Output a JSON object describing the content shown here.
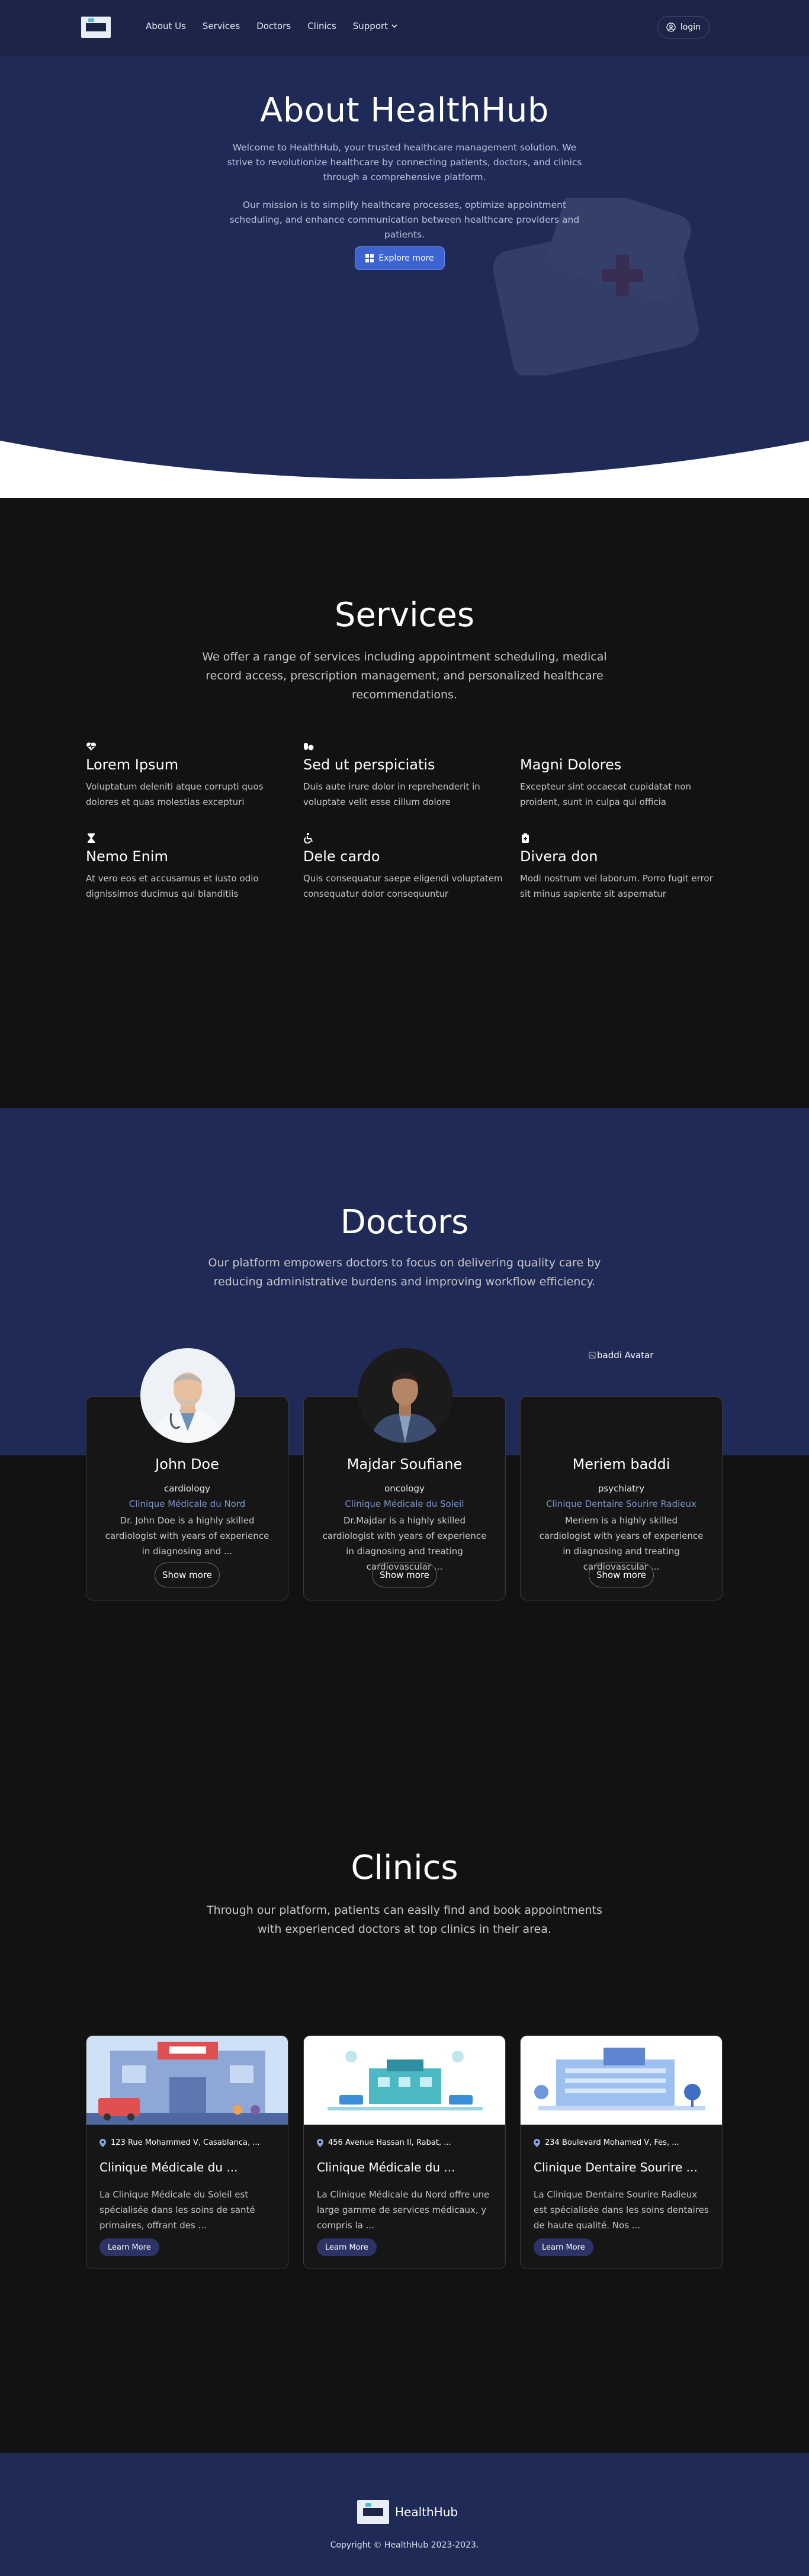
{
  "nav": {
    "links": [
      "About Us",
      "Services",
      "Doctors",
      "Clinics",
      "Support"
    ],
    "login": "login"
  },
  "hero": {
    "title": "About HealthHub",
    "p1": "Welcome to HealthHub, your trusted healthcare management solution. We strive to revolutionize healthcare by connecting patients, doctors, and clinics through a comprehensive platform.",
    "p2": "Our mission is to simplify healthcare processes, optimize appointment scheduling, and enhance communication between healthcare providers and patients.",
    "cta": "Explore more"
  },
  "services": {
    "title": "Services",
    "subtitle": "We offer a range of services including appointment scheduling, medical record access, prescription management, and personalized healthcare recommendations.",
    "items": [
      {
        "icon": "heart-pulse-icon",
        "title": "Lorem Ipsum",
        "text": "Voluptatum deleniti atque corrupti quos dolores et quas molestias excepturi"
      },
      {
        "icon": "pills-icon",
        "title": "Sed ut perspiciatis",
        "text": "Duis aute irure dolor in reprehenderit in voluptate velit esse cillum dolore"
      },
      {
        "icon": "thermometer-icon",
        "title": "Magni Dolores",
        "text": "Excepteur sint occaecat cupidatat non proident, sunt in culpa qui officia"
      },
      {
        "icon": "hourglass-icon",
        "title": "Nemo Enim",
        "text": "At vero eos et accusamus et iusto odio dignissimos ducimus qui blanditiis"
      },
      {
        "icon": "wheelchair-icon",
        "title": "Dele cardo",
        "text": "Quis consequatur saepe eligendi voluptatem consequatur dolor consequuntur"
      },
      {
        "icon": "medical-bag-icon",
        "title": "Divera don",
        "text": "Modi nostrum vel laborum. Porro fugit error sit minus sapiente sit aspernatur"
      }
    ]
  },
  "doctors": {
    "title": "Doctors",
    "subtitle": "Our platform empowers doctors to focus on delivering quality care by reducing administrative burdens and improving workflow efficiency.",
    "items": [
      {
        "name": "John Doe",
        "specialty": "cardiology",
        "clinic": "Clinique Médicale du Nord",
        "desc": "Dr. John Doe is a highly skilled cardiologist with years of experience in diagnosing and ..."
      },
      {
        "name": "Majdar Soufiane",
        "specialty": "oncology",
        "clinic": "Clinique Médicale du Soleil",
        "desc": "Dr.Majdar is a highly skilled cardiologist with years of experience in diagnosing and treating cardiovascular ..."
      },
      {
        "name": "Meriem baddi",
        "specialty": "psychiatry",
        "clinic": "Clinique Dentaire Sourire Radieux",
        "desc": "Meriem is a highly skilled cardiologist with years of experience in diagnosing and treating cardiovascular ..."
      }
    ],
    "show_more": "Show more",
    "broken_avatar_alt": "baddi Avatar"
  },
  "clinics": {
    "title": "Clinics",
    "subtitle": "Through our platform, patients can easily find and book appointments with experienced doctors at top clinics in their area.",
    "items": [
      {
        "address": "123 Rue Mohammed V, Casablanca, ...",
        "name": "Clinique Médicale du ...",
        "desc": "La Clinique Médicale du Soleil est spécialisée dans les soins de santé primaires, offrant des ..."
      },
      {
        "address": "456 Avenue Hassan II, Rabat, ...",
        "name": "Clinique Médicale du ...",
        "desc": "La Clinique Médicale du Nord offre une large gamme de services médicaux, y compris la ..."
      },
      {
        "address": "234 Boulevard Mohamed V, Fes, ...",
        "name": "Clinique Dentaire Sourire ...",
        "desc": "La Clinique Dentaire Sourire Radieux est spécialisée dans les soins dentaires de haute qualité. Nos ..."
      }
    ],
    "learn_more": "Learn More"
  },
  "footer": {
    "brand": "HealthHub",
    "copyright": "Copyright © HealthHub 2023-2023."
  },
  "colors": {
    "navy": "#1f2a57",
    "dark": "#121212",
    "accent": "#3d63d1",
    "clinic_link": "#7b97c9"
  }
}
